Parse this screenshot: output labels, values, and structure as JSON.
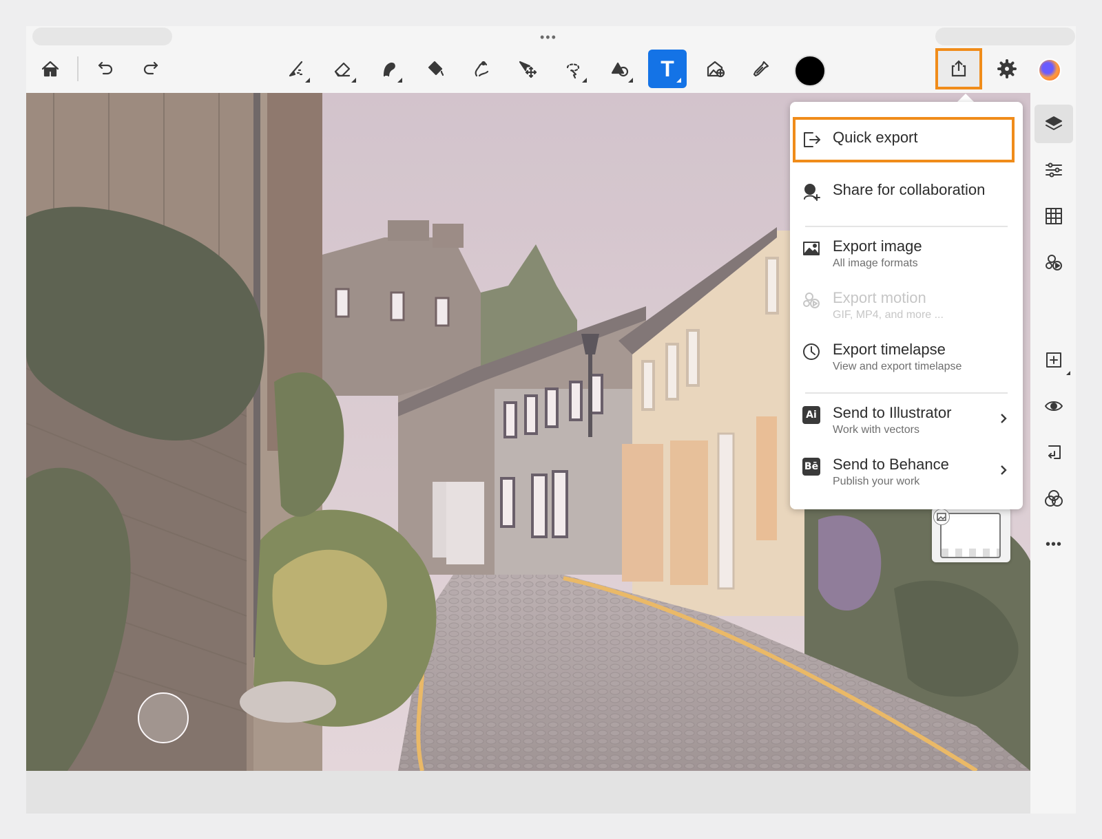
{
  "toolbar": {
    "tools": [
      "home-icon",
      "undo-icon",
      "redo-icon",
      "brush-icon",
      "eraser-icon",
      "smudge-icon",
      "fill-icon",
      "liquify-icon",
      "transform-icon",
      "selection-icon",
      "shape-icon",
      "text-icon",
      "place-image-icon",
      "eyedropper-icon"
    ],
    "active_tool": "text-icon",
    "current_color": "#000000",
    "text_tool_glyph": "T",
    "highlight_color": "#f08c1a",
    "active_color": "#1473e6"
  },
  "export_menu": {
    "quick_export": "Quick export",
    "share": "Share for collaboration",
    "export_image": {
      "title": "Export image",
      "subtitle": "All image formats"
    },
    "export_motion": {
      "title": "Export motion",
      "subtitle": "GIF, MP4, and more ...",
      "disabled": true
    },
    "export_timelapse": {
      "title": "Export timelapse",
      "subtitle": "View and export timelapse"
    },
    "send_illustrator": {
      "title": "Send to Illustrator",
      "subtitle": "Work with vectors",
      "badge": "Ai"
    },
    "send_behance": {
      "title": "Send to Behance",
      "subtitle": "Publish your work",
      "badge": "Bē"
    }
  },
  "right_rail": [
    "layers-icon",
    "adjustments-icon",
    "grid-icon",
    "animation-icon",
    "add-layer-icon",
    "visibility-icon",
    "import-icon",
    "blend-icon",
    "more-icon"
  ],
  "top_dots": "•••",
  "more_dots": "•••"
}
